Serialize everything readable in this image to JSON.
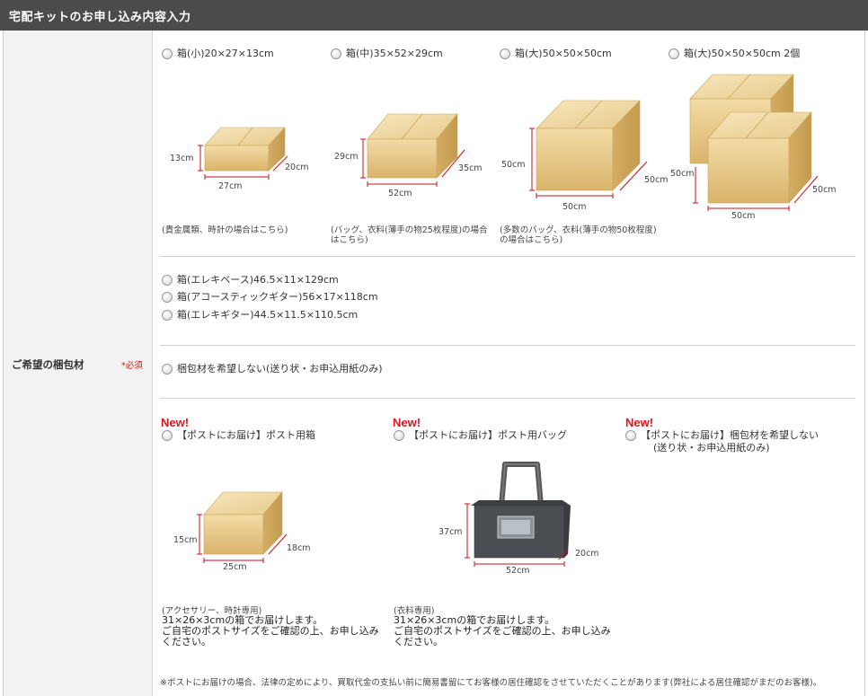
{
  "header": {
    "title": "宅配キットのお申し込み内容入力"
  },
  "field": {
    "label": "ご希望の梱包材",
    "required": "*必須"
  },
  "row1": [
    {
      "label": "箱(小)20×27×13cm",
      "dims": {
        "h": "13cm",
        "w": "27cm",
        "d": "20cm"
      },
      "note": "(貴金属類、時計の場合はこちら)"
    },
    {
      "label": "箱(中)35×52×29cm",
      "dims": {
        "h": "29cm",
        "w": "52cm",
        "d": "35cm"
      },
      "note1": "(バッグ、衣料(薄手の物25枚程度)の場合",
      "note2": "はこちら)"
    },
    {
      "label": "箱(大)50×50×50cm",
      "dims": {
        "h": "50cm",
        "w": "50cm",
        "d": "50cm"
      },
      "note1": "(多数のバッグ、衣料(薄手の物50枚程度)",
      "note2": "の場合はこちら)"
    },
    {
      "label": "箱(大)50×50×50cm 2個",
      "dims": {
        "h": "50cm",
        "w": "50cm",
        "d": "50cm"
      }
    }
  ],
  "row2": [
    {
      "label": "箱(エレキベース)46.5×11×129cm"
    },
    {
      "label": "箱(アコースティックギター)56×17×118cm"
    },
    {
      "label": "箱(エレキギター)44.5×11.5×110.5cm"
    }
  ],
  "row3": {
    "label": "梱包材を希望しない(送り状・お申込用紙のみ)"
  },
  "row4": {
    "new_label": "New!",
    "items": [
      {
        "label": "【ポストにお届け】ポスト用箱",
        "dims": {
          "h": "15cm",
          "w": "25cm",
          "d": "18cm"
        },
        "small": "(アクセサリー、時計専用)",
        "desc1": "31×26×3cmの箱でお届けします。",
        "desc2": "ご自宅のポストサイズをご確認の上、お申し込み",
        "desc3": "ください。"
      },
      {
        "label": "【ポストにお届け】ポスト用バッグ",
        "dims": {
          "h": "37cm",
          "w": "52cm",
          "d": "20cm"
        },
        "small": "(衣料専用)",
        "desc1": "31×26×3cmの箱でお届けします。",
        "desc2": "ご自宅のポストサイズをご確認の上、お申し込み",
        "desc3": "ください。"
      },
      {
        "label1": "【ポストにお届け】梱包材を希望しない",
        "label2": "(送り状・お申込用紙のみ)"
      }
    ]
  },
  "footnote": "※ポストにお届けの場合、法律の定めにより、買取代金の支払い前に簡易書留にてお客様の居住確認をさせていただくことがあります(弊社による居住確認がまだのお客様)。",
  "colors": {
    "header_bg": "#4b4b4b",
    "label_bg": "#f2f2f2",
    "accent_red": "#e0141e",
    "dim_line": "#c4111b",
    "box": "#e2c184"
  }
}
